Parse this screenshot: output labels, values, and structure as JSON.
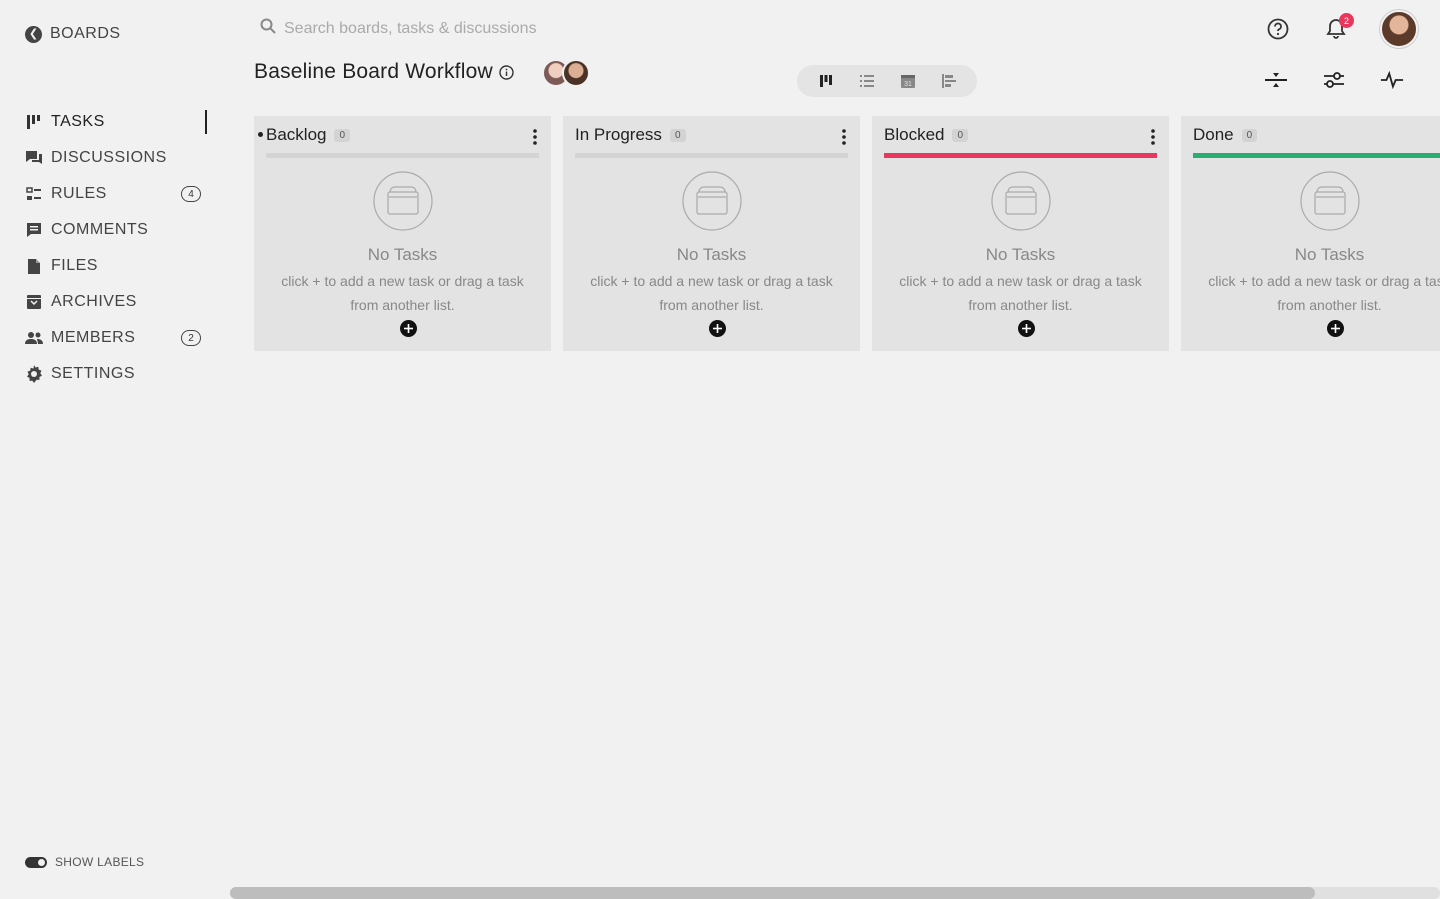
{
  "sidebar": {
    "back_label": "BOARDS",
    "items": [
      {
        "label": "TASKS",
        "icon": "board-columns-icon",
        "active": true,
        "badge": null
      },
      {
        "label": "DISCUSSIONS",
        "icon": "chat-bubbles-icon",
        "active": false,
        "badge": null
      },
      {
        "label": "RULES",
        "icon": "rules-icon",
        "active": false,
        "badge": "4"
      },
      {
        "label": "COMMENTS",
        "icon": "comment-icon",
        "active": false,
        "badge": null
      },
      {
        "label": "FILES",
        "icon": "file-icon",
        "active": false,
        "badge": null
      },
      {
        "label": "ARCHIVES",
        "icon": "archive-icon",
        "active": false,
        "badge": null
      },
      {
        "label": "MEMBERS",
        "icon": "members-icon",
        "active": false,
        "badge": "2"
      },
      {
        "label": "SETTINGS",
        "icon": "gear-icon",
        "active": false,
        "badge": null
      }
    ],
    "show_labels": "SHOW LABELS"
  },
  "header": {
    "search_placeholder": "Search boards, tasks & discussions",
    "notification_count": "2"
  },
  "board": {
    "title": "Baseline Board Workflow"
  },
  "lists": [
    {
      "name": "Backlog",
      "count": "0",
      "bar_color": "#d4d4d4",
      "empty_title": "No Tasks",
      "empty_text": "click + to add a new task or drag a task from another list."
    },
    {
      "name": "In Progress",
      "count": "0",
      "bar_color": "#d4d4d4",
      "empty_title": "No Tasks",
      "empty_text": "click + to add a new task or drag a task from another list."
    },
    {
      "name": "Blocked",
      "count": "0",
      "bar_color": "#e8365d",
      "empty_title": "No Tasks",
      "empty_text": "click + to add a new task or drag a task from another list."
    },
    {
      "name": "Done",
      "count": "0",
      "bar_color": "#27ae70",
      "empty_title": "No Tasks",
      "empty_text": "click + to add a new task or drag a task from another list."
    }
  ],
  "colors": {
    "accent_red": "#e8365d",
    "accent_green": "#27ae70",
    "background": "#f1f1f1"
  }
}
